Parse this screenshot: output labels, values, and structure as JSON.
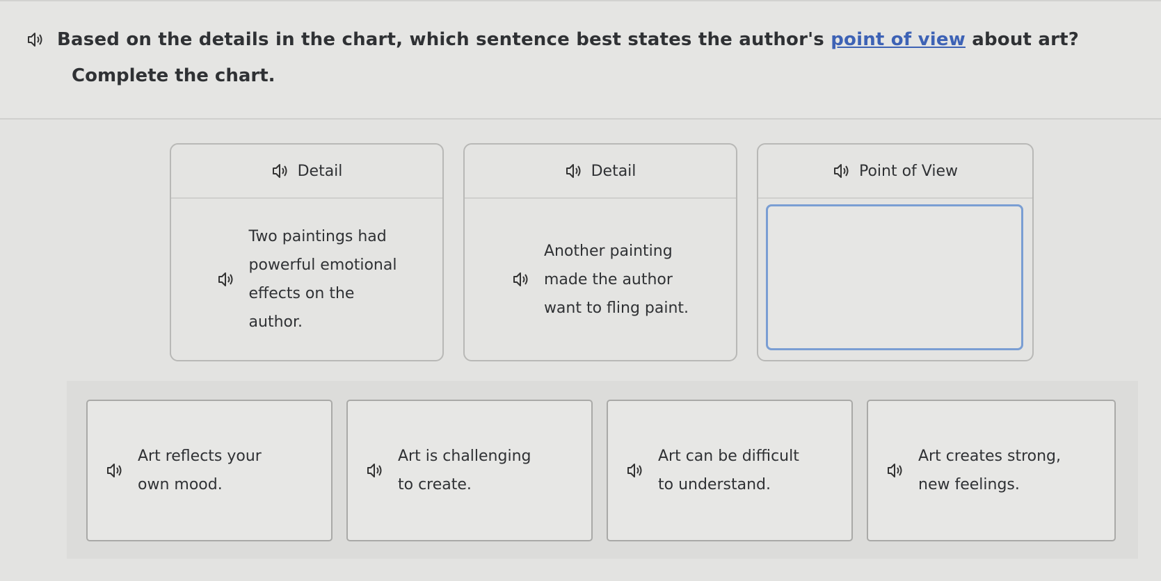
{
  "question": {
    "prefix": "Based on the details in the chart, which sentence best states the author's ",
    "link": "point of view",
    "suffix": " about art?",
    "instruction": "Complete the chart."
  },
  "chart": {
    "columns": [
      {
        "heading": "Detail",
        "body_lines": [
          "Two paintings had",
          "powerful emotional",
          "effects on the",
          "author."
        ]
      },
      {
        "heading": "Detail",
        "body_lines": [
          "Another painting",
          "made the author",
          "want to fling paint."
        ]
      },
      {
        "heading": "Point of View",
        "answer": ""
      }
    ]
  },
  "options": [
    {
      "lines": [
        "Art reflects your",
        "own mood."
      ]
    },
    {
      "lines": [
        "Art is challenging",
        "to create."
      ]
    },
    {
      "lines": [
        "Art can be difficult",
        "to understand."
      ]
    },
    {
      "lines": [
        "Art creates strong,",
        "new feelings."
      ]
    }
  ],
  "icons": {
    "audio": "speaker-icon"
  },
  "colors": {
    "link": "#3d62b5",
    "answer_border": "#7a9ed3"
  }
}
